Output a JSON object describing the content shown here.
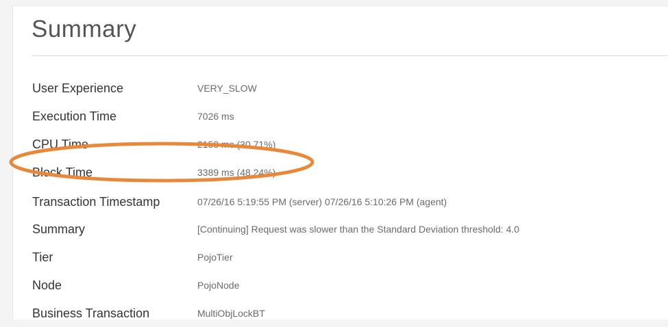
{
  "summary": {
    "title": "Summary",
    "rows": [
      {
        "label": "User Experience",
        "value": "VERY_SLOW"
      },
      {
        "label": "Execution Time",
        "value": "7026 ms"
      },
      {
        "label": "CPU Time",
        "value": "2158 ms (30.71%)"
      },
      {
        "label": "Block Time",
        "value": "3389 ms (48.24%)"
      },
      {
        "label": "Transaction Timestamp",
        "value": "07/26/16 5:19:55 PM (server) 07/26/16 5:10:26 PM (agent)"
      },
      {
        "label": "Summary",
        "value": "[Continuing] Request was slower than the Standard Deviation threshold: 4.0"
      },
      {
        "label": "Tier",
        "value": "PojoTier"
      },
      {
        "label": "Node",
        "value": "PojoNode"
      },
      {
        "label": "Business Transaction",
        "value": "MultiObjLockBT"
      }
    ]
  },
  "annotation": {
    "color": "#e8883a"
  }
}
